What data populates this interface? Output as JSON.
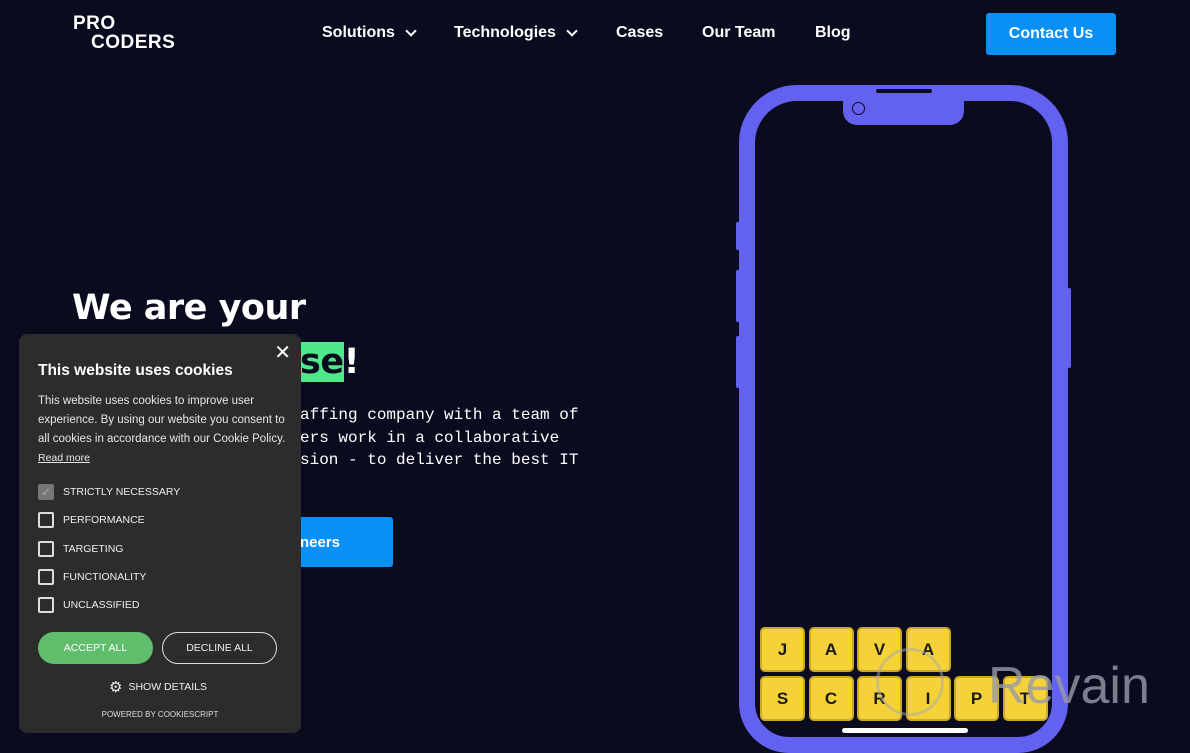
{
  "header": {
    "logo": {
      "line1": "PRO",
      "line2": "CODERS"
    },
    "nav": [
      {
        "label": "Solutions",
        "dropdown": true
      },
      {
        "label": "Technologies",
        "dropdown": true
      },
      {
        "label": "Cases"
      },
      {
        "label": "Our Team"
      },
      {
        "label": "Blog"
      }
    ],
    "contact_label": "Contact Us",
    "accent": "#0a8ff5"
  },
  "hero": {
    "title_line1": "We are your",
    "title_highlight": "se",
    "title_end": "!",
    "paragraph": [
      "affing company with a team of",
      "ers work in a collaborative",
      "sion - to deliver the best IT"
    ],
    "cta_label": "neers",
    "highlight_color": "#4ee88a"
  },
  "phone": {
    "color": "#6361ef",
    "keys_row1": [
      "J",
      "A",
      "V",
      "A"
    ],
    "keys_row2": [
      "S",
      "C",
      "R",
      "I",
      "P",
      "T"
    ]
  },
  "watermark": "Revain",
  "cookie": {
    "title": "This website uses cookies",
    "text": "This website uses cookies to improve user experience. By using our website you consent to all cookies in accordance with our Cookie Policy.",
    "read_more": "Read more",
    "options": [
      {
        "label": "STRICTLY NECESSARY",
        "checked": true
      },
      {
        "label": "PERFORMANCE",
        "checked": false
      },
      {
        "label": "TARGETING",
        "checked": false
      },
      {
        "label": "FUNCTIONALITY",
        "checked": false
      },
      {
        "label": "UNCLASSIFIED",
        "checked": false
      }
    ],
    "accept_label": "ACCEPT ALL",
    "decline_label": "DECLINE ALL",
    "show_details": "SHOW DETAILS",
    "powered": "POWERED BY COOKIESCRIPT"
  }
}
